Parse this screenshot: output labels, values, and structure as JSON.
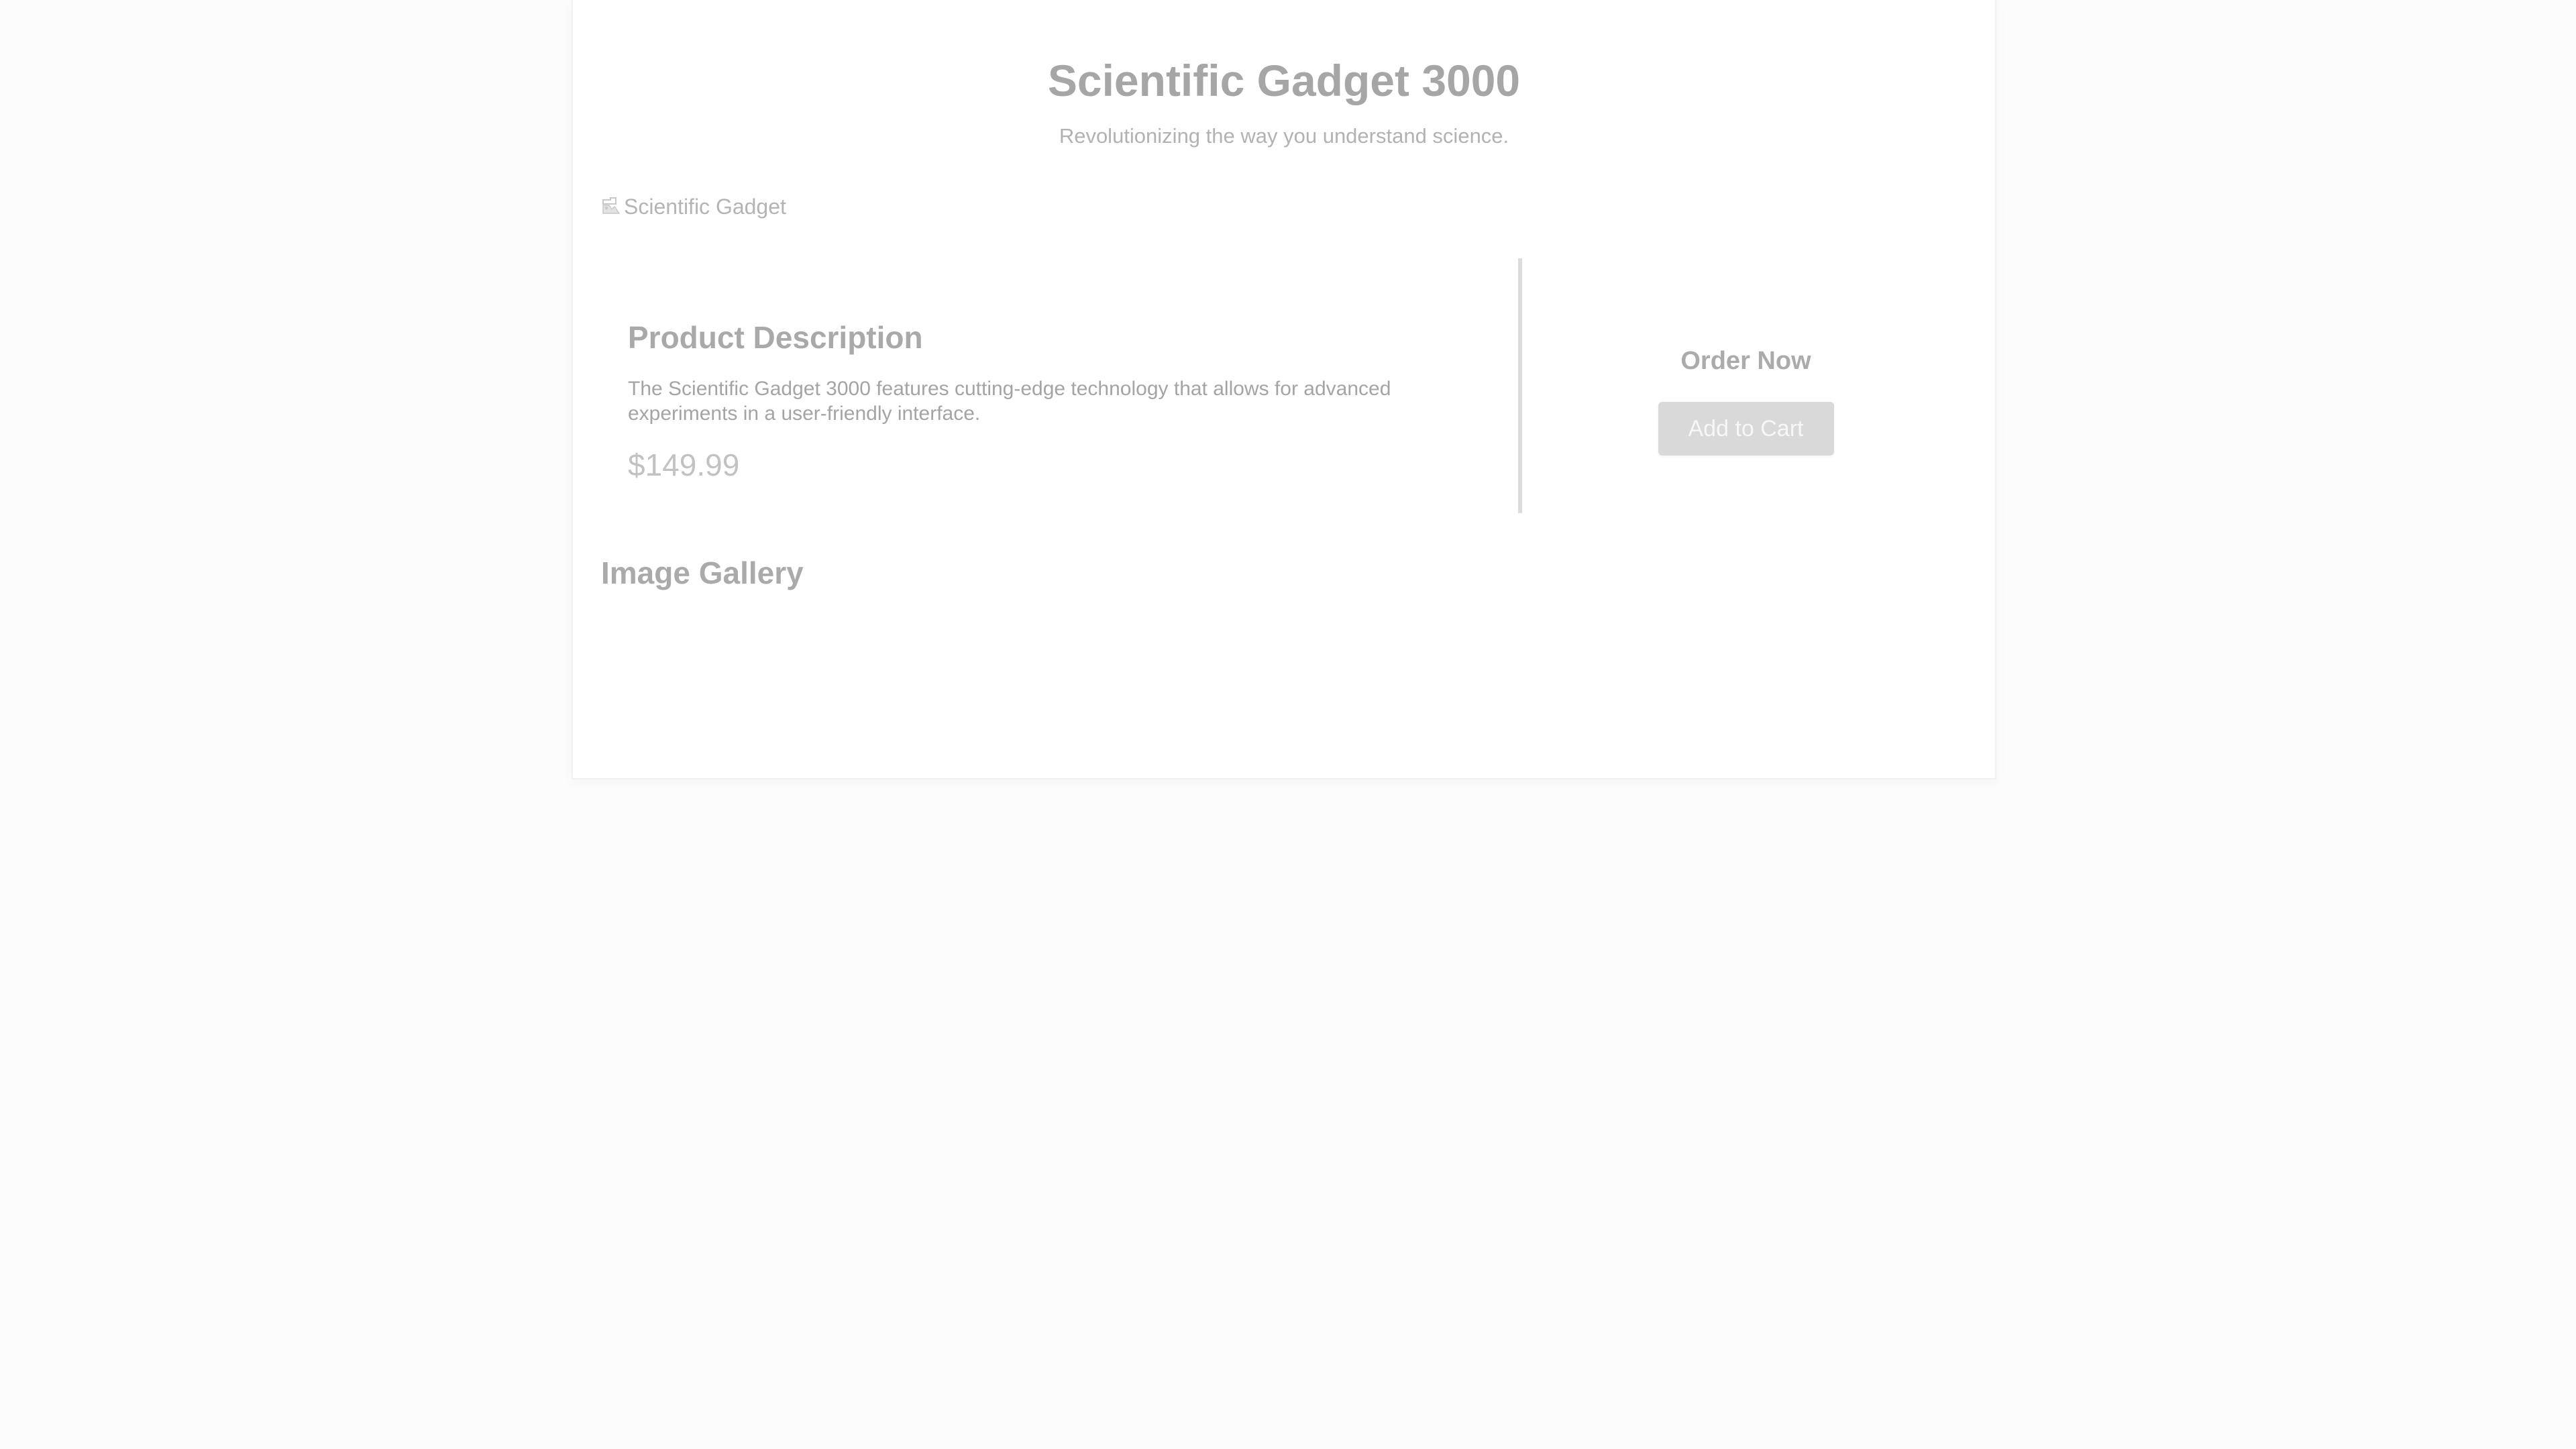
{
  "header": {
    "title": "Scientific Gadget 3000",
    "tagline": "Revolutionizing the way you understand science."
  },
  "product_image": {
    "alt": "Scientific Gadget",
    "icon": "broken-image-icon"
  },
  "description": {
    "heading": "Product Description",
    "text": "The Scientific Gadget 3000 features cutting-edge technology that allows for advanced experiments in a user-friendly interface.",
    "price": "$149.99"
  },
  "order": {
    "heading": "Order Now",
    "button_label": "Add to Cart"
  },
  "gallery": {
    "heading": "Image Gallery"
  },
  "colors": {
    "page_background": "#fcfcfc",
    "card_background": "#ffffff",
    "button_background": "#d9d9d9",
    "divider": "#dcdcdc"
  }
}
